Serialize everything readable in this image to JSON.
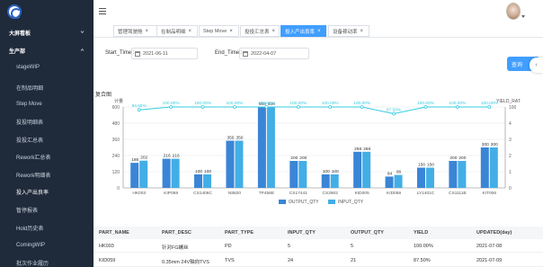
{
  "sidebar": {
    "group1": "大屏看板",
    "group2": "生产部",
    "items": [
      {
        "label": "stageWIP"
      },
      {
        "label": "在制品明细"
      },
      {
        "label": "Step Move"
      },
      {
        "label": "投投明细表"
      },
      {
        "label": "投投汇总表"
      },
      {
        "label": "Rework汇总表"
      },
      {
        "label": "Rework明细表"
      },
      {
        "label": "投入产出良率"
      },
      {
        "label": "暂停报表"
      },
      {
        "label": "Hold历史表"
      },
      {
        "label": "ComingWIP"
      },
      {
        "label": "批次作业履历"
      }
    ]
  },
  "tabs": [
    {
      "label": "管理驾驶舱"
    },
    {
      "label": "在制品明细"
    },
    {
      "label": "Step Move"
    },
    {
      "label": "投投汇总表"
    },
    {
      "label": "投入产出良率"
    },
    {
      "label": "设备稼动率"
    }
  ],
  "filters": {
    "start_label": "Start_Time :",
    "start_value": "2021-06-11",
    "end_label": "End_Time :",
    "end_value": "2022-04-07",
    "query_label": "查询"
  },
  "chart_title": "复合图",
  "chart_data": {
    "type": "bar",
    "categories": [
      "HK003",
      "KIP059",
      "CS1406C",
      "N8820",
      "TP458E",
      "CS17441",
      "CS2902",
      "KID005",
      "KID059",
      "LY1401C",
      "CS1111B",
      "KIT006"
    ],
    "series": [
      {
        "name": "OUTPUT_QTY",
        "values": [
          186,
          216,
          100,
          350,
          600,
          200,
          100,
          268,
          84,
          150,
          200,
          300
        ],
        "color": "#3a85d6"
      },
      {
        "name": "INPUT_QTY",
        "values": [
          202,
          216,
          100,
          350,
          600,
          200,
          100,
          268,
          96,
          150,
          200,
          300
        ],
        "color": "#43aee6"
      }
    ],
    "line": {
      "name": "YIELD_RATE",
      "values": [
        94.65,
        100,
        100,
        100,
        100,
        100,
        100,
        100,
        87.5,
        100,
        100,
        100
      ],
      "labels": [
        "94.65%",
        "100.00%",
        "100.00%",
        "100.00%",
        "100.00%",
        "100.00%",
        "100.00%",
        "100.00%",
        "87.50%",
        "100.00%",
        "100.00%",
        "100.00%"
      ],
      "color": "#35cbe0"
    },
    "left_axis": {
      "label": "计量",
      "ticks": [
        0,
        120,
        240,
        360,
        480,
        600
      ],
      "ylim": [
        0,
        600
      ]
    },
    "right_axis": {
      "label": "YIELD_RAT",
      "ticks": [
        "0",
        "1",
        "2",
        "3",
        "4",
        "100"
      ]
    },
    "legend_position": "bottom",
    "legend": [
      "OUTPUT_QTY",
      "INPUT_QTY"
    ]
  },
  "table": {
    "headers": [
      "PART_NAME",
      "PART_DESC",
      "PART_TYPE",
      "INPUT_QTY",
      "OUTPUT_QTY",
      "YIELD",
      "UPDATED(day)"
    ],
    "rows": [
      [
        "HK003",
        "针对FG螺丝",
        "PD",
        "5",
        "5",
        "100.00%",
        "2021-07-08"
      ],
      [
        "KID059",
        "0.35mm 24V轴向TVS",
        "TVS",
        "24",
        "21",
        "87.50%",
        "2021-07-09"
      ]
    ]
  }
}
